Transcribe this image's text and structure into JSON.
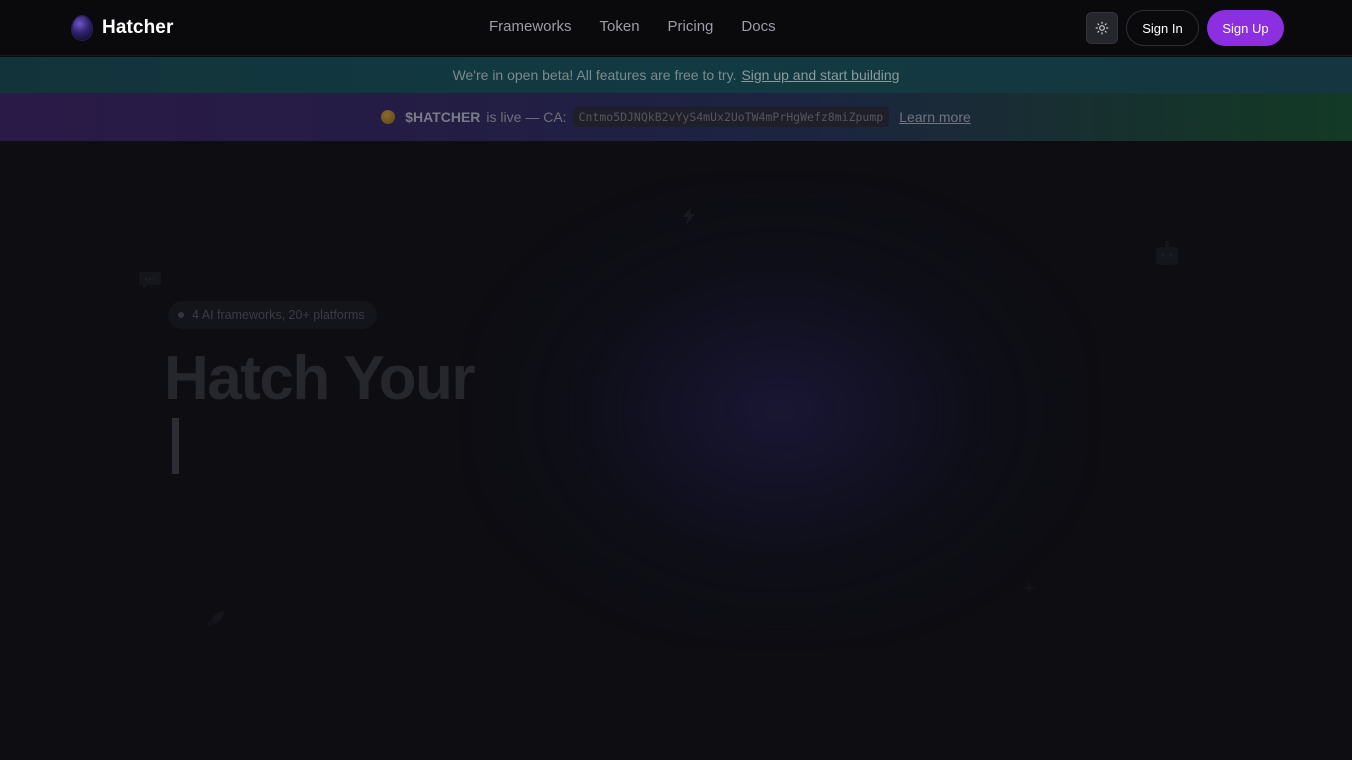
{
  "header": {
    "brand": "Hatcher",
    "nav": [
      {
        "label": "Frameworks"
      },
      {
        "label": "Token"
      },
      {
        "label": "Pricing"
      },
      {
        "label": "Docs"
      }
    ],
    "theme_toggle_icon": "sun-icon",
    "sign_in": "Sign In",
    "sign_up": "Sign Up"
  },
  "beta_banner": {
    "text": "We're in open beta! All features are free to try.",
    "link": "Sign up and start building"
  },
  "token_banner": {
    "symbol": "$HATCHER",
    "text": "is live — CA:",
    "contract": "Cntmo5DJNQkB2vYyS4mUx2UoTW4mPrHgWefz8miZpump",
    "link": "Learn more"
  },
  "hero": {
    "badge": "4 AI frameworks, 20+ platforms",
    "title": "Hatch Your"
  },
  "colors": {
    "accent": "#8b2fe0",
    "background": "#0b0b0f"
  }
}
